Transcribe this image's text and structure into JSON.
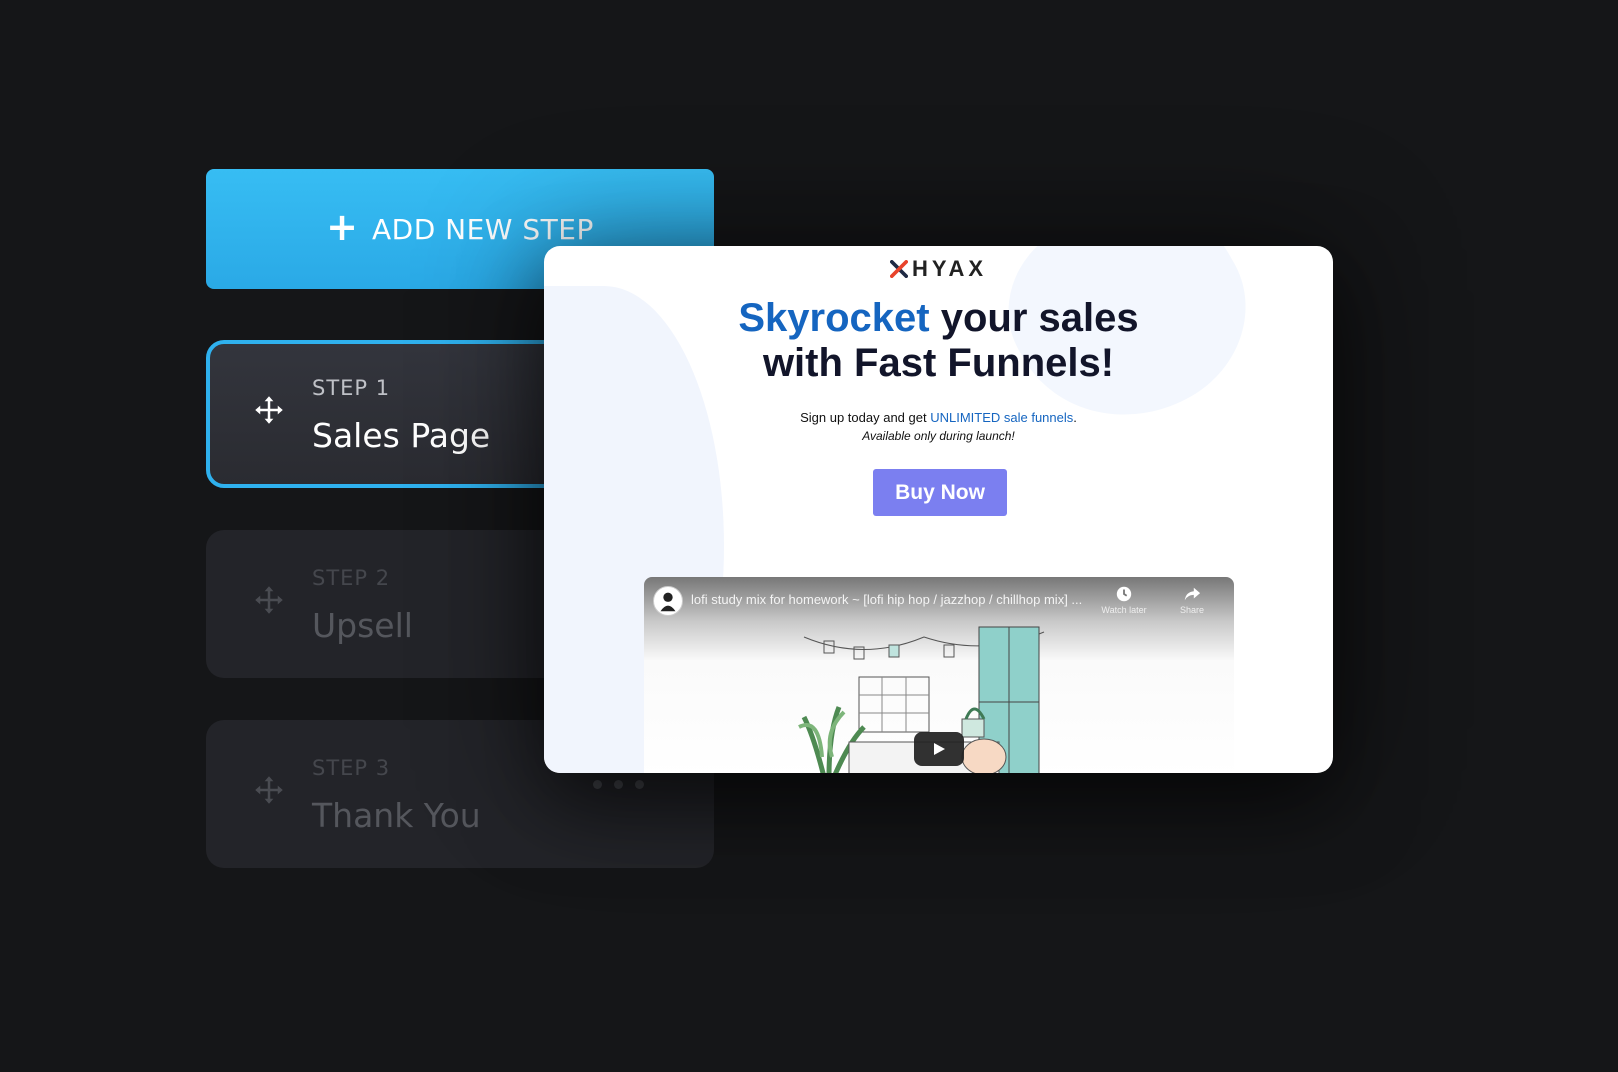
{
  "add_step": {
    "label": "ADD NEW STEP",
    "icon": "plus-icon"
  },
  "steps": [
    {
      "number": "STEP 1",
      "title": "Sales Page",
      "active": true
    },
    {
      "number": "STEP 2",
      "title": "Upsell",
      "active": false
    },
    {
      "number": "STEP 3",
      "title": "Thank You",
      "active": false
    }
  ],
  "preview": {
    "logo": "HYAX",
    "headline": {
      "highlight": "Skyrocket",
      "line1_rest": " your sales",
      "line2": "with Fast Funnels!"
    },
    "subtext": {
      "before": "Sign up today and get ",
      "link": "UNLIMITED sale funnels",
      "after": "."
    },
    "note": "Available only during launch!",
    "cta": "Buy Now",
    "video": {
      "title": "lofi study mix for homework ~ [lofi hip hop / jazzhop / chillhop mix] ...",
      "watch_later": "Watch later",
      "share": "Share"
    }
  },
  "colors": {
    "background": "#151618",
    "accent": "#2fb1ee",
    "headline_blue": "#1565c0",
    "cta": "#7b7ff0"
  }
}
